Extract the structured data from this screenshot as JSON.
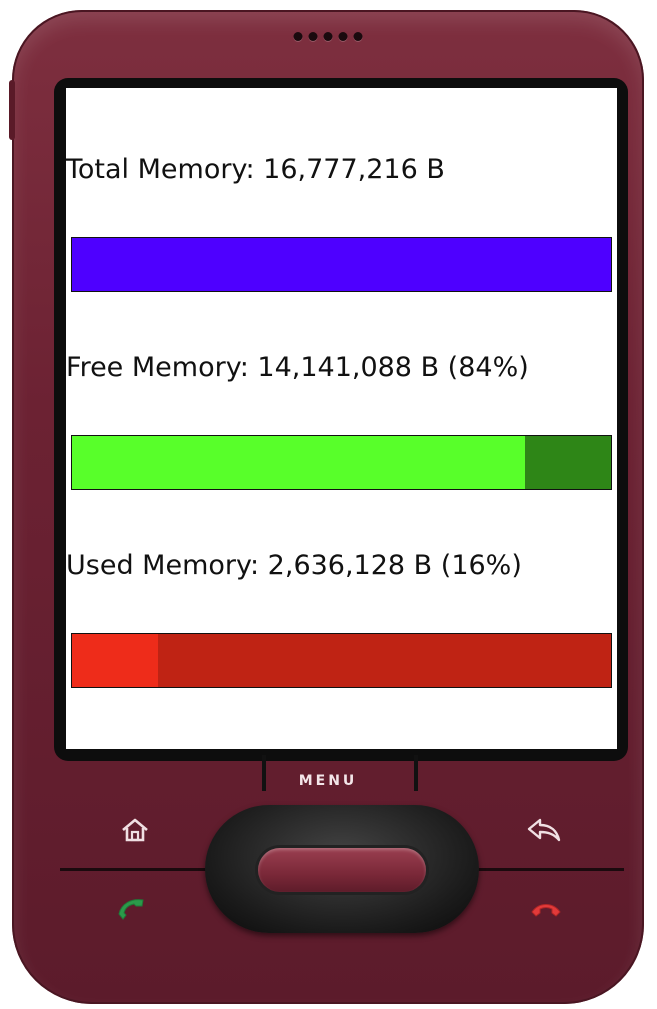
{
  "device": {
    "menu_label": "MENU",
    "body_color": "#6c2233",
    "hardware_icons": [
      "home-icon",
      "back-icon",
      "call-icon",
      "end-call-icon"
    ]
  },
  "memory": {
    "total": {
      "label": "Total Memory: 16,777,216 B",
      "fraction": 1.0,
      "fill_color": "#4e00ff",
      "track_color": "#4e00ff"
    },
    "free": {
      "label": "Free Memory: 14,141,088 B (84%)",
      "fraction": 0.84,
      "fill_color": "#58ff2a",
      "track_color": "#2e8617"
    },
    "used": {
      "label": "Used Memory: 2,636,128 B (16%)",
      "fraction": 0.16,
      "fill_color": "#ee2c1a",
      "track_color": "#bf2314"
    }
  }
}
